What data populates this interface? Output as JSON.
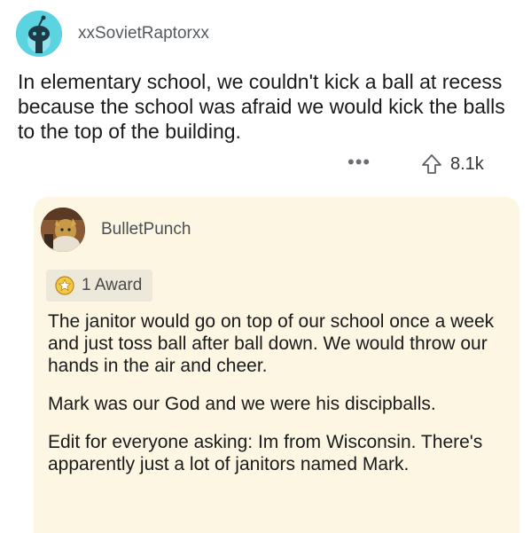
{
  "parent_comment": {
    "username": "xxSovietRaptorxx",
    "body": "In elementary school, we couldn't kick a ball at recess because the school was afraid we would kick the balls to the top of the building.",
    "more_icon": "ellipsis-icon",
    "upvote_icon": "upvote-arrow-icon",
    "vote_count": "8.1k",
    "avatar_color": "#5bd3e0"
  },
  "reply_comment": {
    "username": "BulletPunch",
    "award_label": "1 Award",
    "award_icon": "award-icon",
    "paragraphs": [
      "The janitor would go on top of our school once a week and just toss ball after ball down. We would throw our hands in the air and cheer.",
      "Mark was our God and we were his discipballs.",
      "Edit for everyone asking: Im from Wisconsin. There's apparently just a lot of janitors named Mark."
    ],
    "card_color": "#fcf6e2"
  }
}
